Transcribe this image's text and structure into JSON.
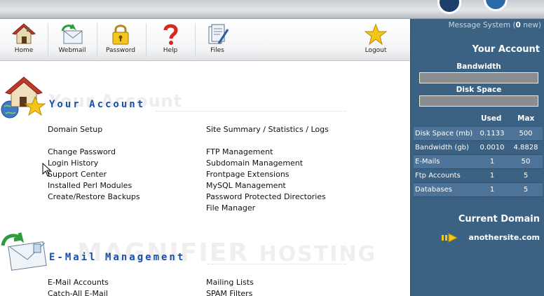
{
  "toolbar": {
    "items": [
      {
        "label": "Home",
        "icon": "home-icon"
      },
      {
        "label": "Webmail",
        "icon": "webmail-icon"
      },
      {
        "label": "Password",
        "icon": "lock-icon"
      },
      {
        "label": "Help",
        "icon": "question-mark-icon"
      },
      {
        "label": "Files",
        "icon": "files-icon"
      },
      {
        "label": "Logout",
        "icon": "star-icon"
      }
    ]
  },
  "panel": {
    "message_prefix": "Message System (",
    "message_count": "0",
    "message_suffix": " new)",
    "your_account": "Your Account",
    "bandwidth_label": "Bandwidth",
    "disk_label": "Disk Space",
    "bandwidth_fill": 0.0,
    "disk_fill": 0.0,
    "col_used": "Used",
    "col_max": "Max",
    "stats": [
      {
        "name": "Disk Space (mb)",
        "used": "0.1133",
        "max": "500"
      },
      {
        "name": "Bandwidth (gb)",
        "used": "0.0010",
        "max": "4.8828"
      },
      {
        "name": "E-Mails",
        "used": "1",
        "max": "50"
      },
      {
        "name": "Ftp Accounts",
        "used": "1",
        "max": "5"
      },
      {
        "name": "Databases",
        "used": "1",
        "max": "5"
      }
    ],
    "current_domain_title": "Current Domain",
    "current_domain": "anothersite.com"
  },
  "sections": {
    "account": {
      "title": "Your Account",
      "ghost": "Your Account",
      "left_links": [
        "Domain Setup",
        "",
        "Change Password",
        "Login History",
        "Support Center",
        "Installed Perl Modules",
        "Create/Restore Backups"
      ],
      "right_links": [
        "Site Summary / Statistics / Logs",
        "",
        "FTP Management",
        "Subdomain Management",
        "Frontpage Extensions",
        "MySQL Management",
        "Password Protected Directories",
        "File Manager"
      ]
    },
    "email": {
      "title": "E-Mail Management",
      "left_links": [
        "E-Mail Accounts",
        "Catch-All E-Mail"
      ],
      "right_links": [
        "Mailing Lists",
        "SPAM Filters"
      ]
    }
  },
  "watermark": {
    "brand": "MAGNIFIER",
    "suffix": "HOSTING"
  },
  "colors": {
    "panel": "#3b6183",
    "title_blue": "#1a4ea8"
  }
}
